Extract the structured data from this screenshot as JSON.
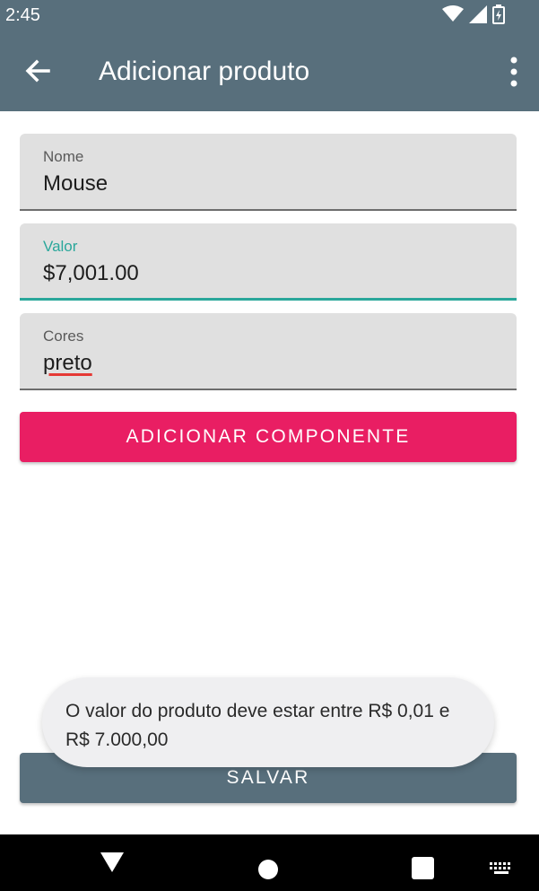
{
  "status_bar": {
    "time": "2:45",
    "icons": [
      "wifi-icon",
      "signal-icon",
      "battery-charging-icon"
    ]
  },
  "app_bar": {
    "title": "Adicionar produto",
    "icons": [
      "back-arrow-icon",
      "more-vert-icon"
    ]
  },
  "form": {
    "fields": [
      {
        "label": "Nome",
        "value": "Mouse"
      },
      {
        "label": "Valor",
        "value": "$7,001.00"
      },
      {
        "label": "Cores",
        "value": "preto"
      }
    ],
    "add_component_label": "ADICIONAR COMPONENTE",
    "save_label": "SALVAR"
  },
  "toast": {
    "message": "O valor do produto deve estar entre R$ 0,01 e R$ 7.000,00"
  },
  "colors": {
    "primary": "#586f7c",
    "accent": "#e91e63",
    "focus": "#2aa79b"
  },
  "nav_bar": {
    "icons": [
      "back-triangle-icon",
      "home-circle-icon",
      "recents-square-icon",
      "keyboard-icon"
    ]
  }
}
